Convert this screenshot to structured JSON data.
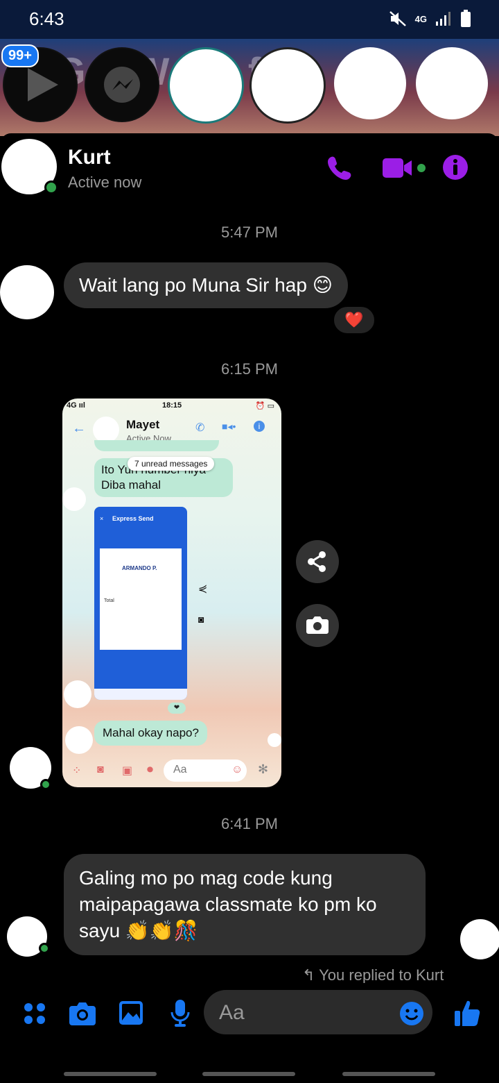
{
  "status": {
    "time": "6:43",
    "network": "4G"
  },
  "heads": {
    "badge": "99+",
    "bg_text": "GC   W  ay  ft"
  },
  "header": {
    "name": "Kurt",
    "status": "Active now"
  },
  "messages": {
    "ts1": "5:47 PM",
    "msg1": "Wait lang po Muna Sir hap 😊",
    "msg1_reaction": "❤️",
    "ts2": "6:15 PM",
    "ts3": "6:41 PM",
    "msg3": "Galing mo po mag code kung maipapagawa classmate ko pm ko sayu 👏👏🎊",
    "reply_note": "You replied to Kurt"
  },
  "shared_image": {
    "status_time": "18:15",
    "contact_name": "Mayet",
    "contact_status": "Active Now",
    "unread": "7 unread messages",
    "bubble1": "Ito Yun number niya\nDiba mahal",
    "card_title": "Express Send",
    "card_name": "ARMANDO P.",
    "card_total": "Total",
    "bubble2": "Mahal okay napo?",
    "input_placeholder": "Aa"
  },
  "composer": {
    "placeholder": "Aa"
  },
  "colors": {
    "accent_purple": "#9b1ee6",
    "accent_blue": "#1877f2",
    "online_green": "#31a24c"
  }
}
